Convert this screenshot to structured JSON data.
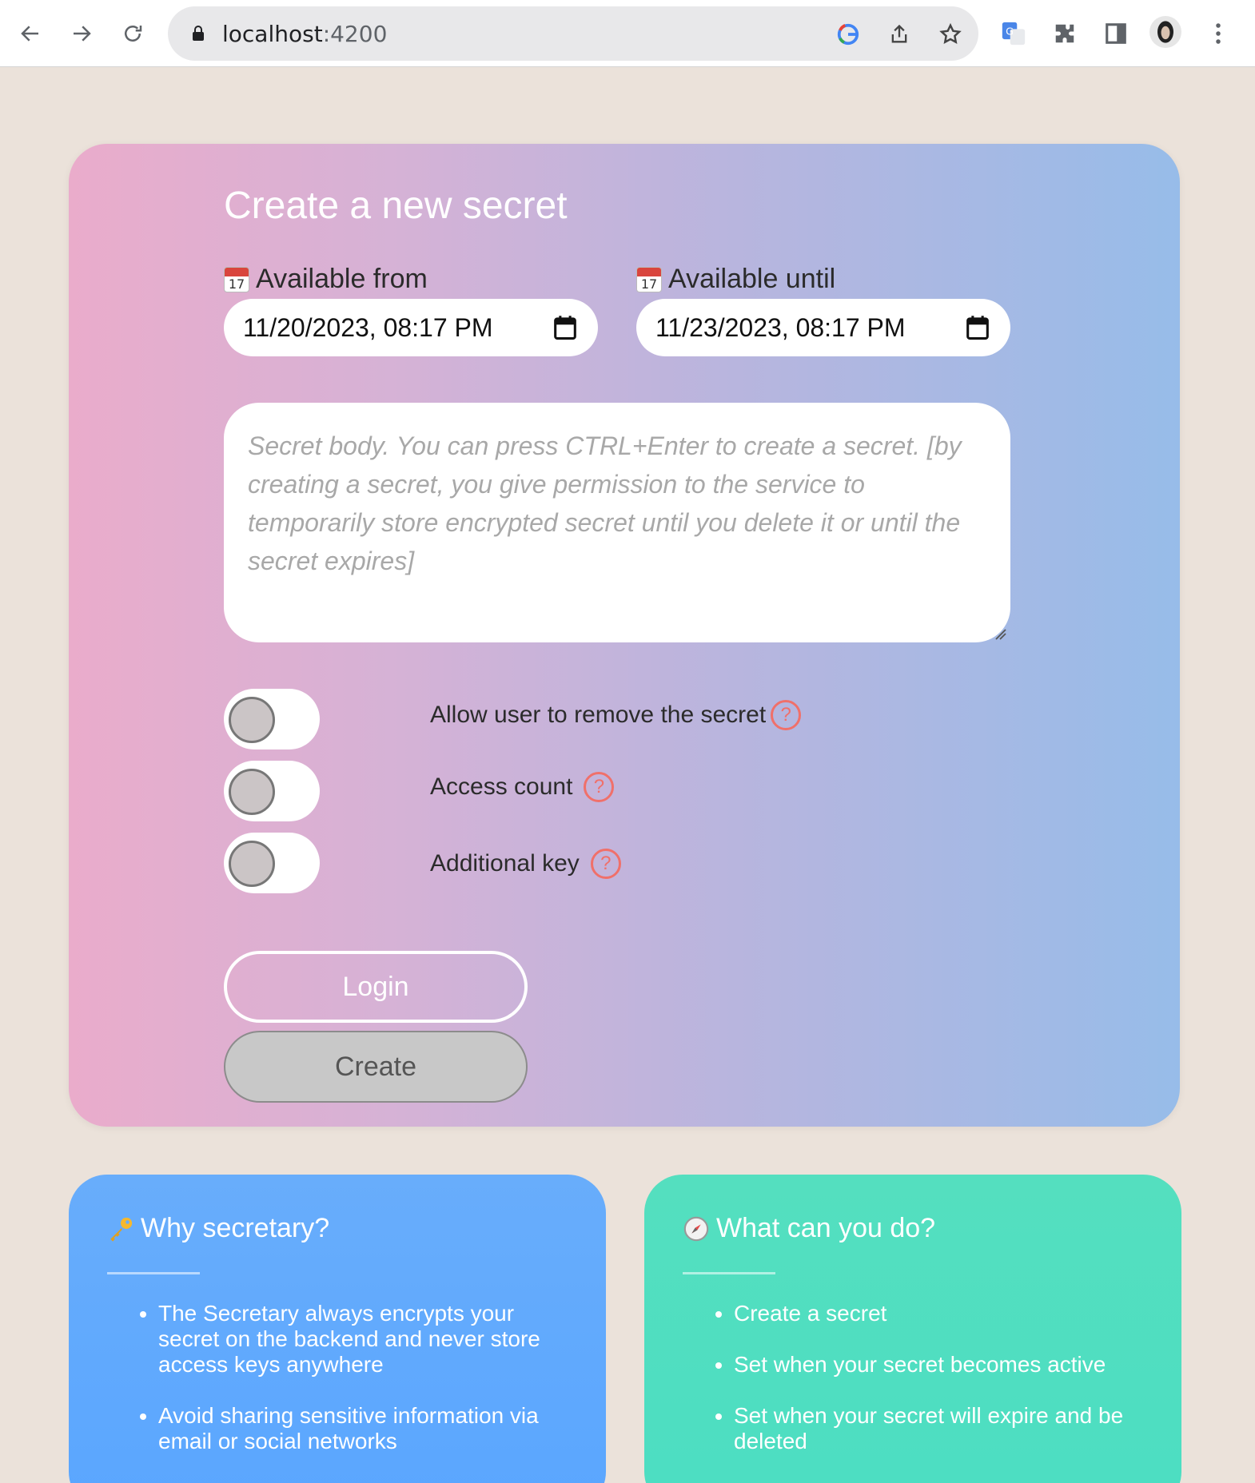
{
  "browser": {
    "url_host": "localhost",
    "url_port": ":4200"
  },
  "form": {
    "title": "Create a new secret",
    "available_from_label": "Available from",
    "available_from_value": "11/20/2023, 08:17 PM",
    "available_until_label": "Available until",
    "available_until_value": "11/23/2023, 08:17 PM",
    "calendar_emoji_number": "17",
    "body_placeholder": "Secret body. You can press CTRL+Enter to create a secret. [by creating a secret, you give permission to the service to temporarily store encrypted secret until you delete it or until the secret expires]",
    "options": [
      {
        "label": "Allow user to remove the secret",
        "help": "?",
        "enabled": false
      },
      {
        "label": "Access count",
        "help": "?",
        "enabled": false
      },
      {
        "label": "Additional key",
        "help": "?",
        "enabled": false
      }
    ],
    "login_label": "Login",
    "create_label": "Create"
  },
  "why": {
    "title": "Why secretary?",
    "icon": "key-icon",
    "items": [
      "The Secretary always encrypts your secret on the backend and never store access keys anywhere",
      "Avoid sharing sensitive information via email or social networks"
    ]
  },
  "what": {
    "title": "What can you do?",
    "icon": "compass-icon",
    "items": [
      "Create a secret",
      "Set when your secret becomes active",
      "Set when your secret will expire and be deleted"
    ]
  },
  "colors": {
    "page_bg": "#ebe2da",
    "gradient_start": "#eaaccb",
    "gradient_end": "#97bce9",
    "help_accent": "#f0706a",
    "blue_card": "#5aa6ff",
    "green_card": "#4cdec2"
  }
}
